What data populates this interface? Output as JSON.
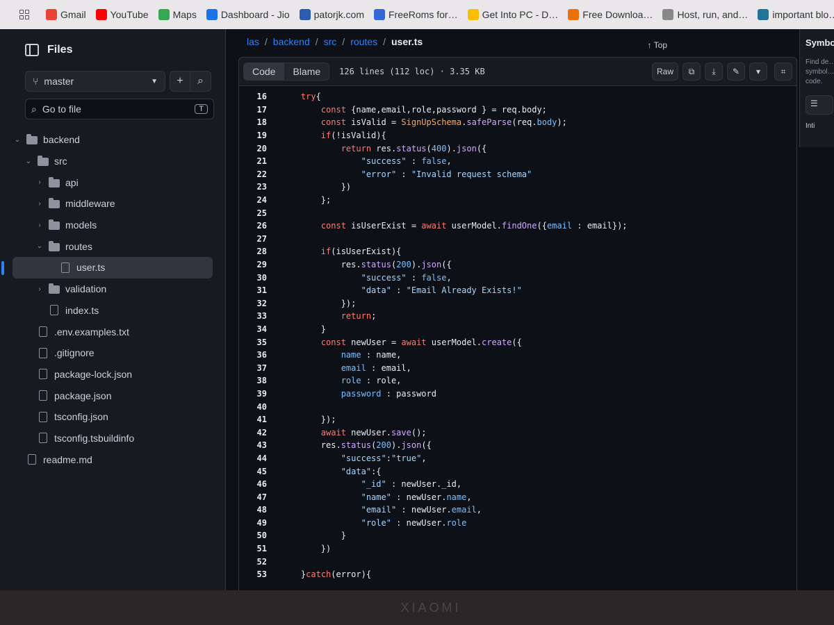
{
  "bookmarks": [
    {
      "label": "Gmail",
      "icon": "gmail-icon",
      "color": "#ea4335"
    },
    {
      "label": "YouTube",
      "icon": "youtube-icon",
      "color": "#ff0000"
    },
    {
      "label": "Maps",
      "icon": "maps-icon",
      "color": "#34a853"
    },
    {
      "label": "Dashboard - Jio",
      "icon": "cloud-icon",
      "color": "#1a73e8"
    },
    {
      "label": "patorjk.com",
      "icon": "pen-icon",
      "color": "#2a5db0"
    },
    {
      "label": "FreeRoms for…",
      "icon": "roms-icon",
      "color": "#3367d6"
    },
    {
      "label": "Get Into PC - D…",
      "icon": "g-icon",
      "color": "#fbbc04"
    },
    {
      "label": "Free Downloa…",
      "icon": "download-icon",
      "color": "#e8710a"
    },
    {
      "label": "Host, run, and…",
      "icon": "host-icon",
      "color": "#888888"
    },
    {
      "label": "important blo…",
      "icon": "wordpress-icon",
      "color": "#21759b"
    }
  ],
  "sidebar": {
    "title": "Files",
    "branch": "master",
    "goto_placeholder": "Go to file",
    "goto_shortcut": "T",
    "tree": [
      {
        "label": "backend",
        "type": "folder",
        "depth": 0,
        "chevron": "⌄"
      },
      {
        "label": "src",
        "type": "folder",
        "depth": 1,
        "chevron": "⌄"
      },
      {
        "label": "api",
        "type": "folder",
        "depth": 2,
        "chevron": "›"
      },
      {
        "label": "middleware",
        "type": "folder",
        "depth": 2,
        "chevron": "›"
      },
      {
        "label": "models",
        "type": "folder",
        "depth": 2,
        "chevron": "›"
      },
      {
        "label": "routes",
        "type": "folder",
        "depth": 2,
        "chevron": "⌄"
      },
      {
        "label": "user.ts",
        "type": "file",
        "depth": 3,
        "chevron": "",
        "selected": true
      },
      {
        "label": "validation",
        "type": "folder",
        "depth": 2,
        "chevron": "›"
      },
      {
        "label": "index.ts",
        "type": "file",
        "depth": 2,
        "chevron": ""
      },
      {
        "label": ".env.examples.txt",
        "type": "file",
        "depth": 1,
        "chevron": ""
      },
      {
        "label": ".gitignore",
        "type": "file",
        "depth": 1,
        "chevron": ""
      },
      {
        "label": "package-lock.json",
        "type": "file",
        "depth": 1,
        "chevron": ""
      },
      {
        "label": "package.json",
        "type": "file",
        "depth": 1,
        "chevron": ""
      },
      {
        "label": "tsconfig.json",
        "type": "file",
        "depth": 1,
        "chevron": ""
      },
      {
        "label": "tsconfig.tsbuildinfo",
        "type": "file",
        "depth": 1,
        "chevron": ""
      },
      {
        "label": "readme.md",
        "type": "file",
        "depth": 0,
        "chevron": ""
      }
    ]
  },
  "breadcrumb": {
    "parts": [
      "las",
      "backend",
      "src",
      "routes"
    ],
    "current": "user.ts"
  },
  "top_link": "↑ Top",
  "toolbar": {
    "code_tab": "Code",
    "blame_tab": "Blame",
    "file_info": "126 lines (112 loc) · 3.35 KB",
    "raw": "Raw"
  },
  "symbols": {
    "title": "Symbols",
    "desc": "Find de…",
    "desc2": "symbol…",
    "desc3": "code.",
    "filter": "Inti"
  },
  "bezel_brand": "XIAOMI",
  "code": {
    "lines": [
      {
        "n": "16",
        "html": "    <span class='kw'>try</span>{"
      },
      {
        "n": "17",
        "html": "        <span class='kw'>const</span> {name,email,role,password } = req.body;"
      },
      {
        "n": "18",
        "html": "        <span class='kw'>const</span> isValid = <span class='cls'>SignUpSchema</span>.<span class='fn'>safeParse</span>(req.<span class='num'>body</span>);"
      },
      {
        "n": "19",
        "html": "        <span class='kw'>if</span>(!isValid){"
      },
      {
        "n": "20",
        "html": "            <span class='kw'>return</span> res.<span class='fn'>status</span>(<span class='num'>400</span>).<span class='fn'>json</span>({"
      },
      {
        "n": "21",
        "html": "                <span class='str'>\"success\"</span> : <span class='num'>false</span>,"
      },
      {
        "n": "22",
        "html": "                <span class='str'>\"error\"</span> : <span class='str'>\"Invalid request schema\"</span>"
      },
      {
        "n": "23",
        "html": "            })"
      },
      {
        "n": "24",
        "html": "        };"
      },
      {
        "n": "25",
        "html": ""
      },
      {
        "n": "26",
        "html": "        <span class='kw'>const</span> isUserExist = <span class='kw'>await</span> userModel.<span class='fn'>findOne</span>({<span class='num'>email</span> : email});"
      },
      {
        "n": "27",
        "html": ""
      },
      {
        "n": "28",
        "html": "        <span class='kw'>if</span>(isUserExist){"
      },
      {
        "n": "29",
        "html": "            res.<span class='fn'>status</span>(<span class='num'>200</span>).<span class='fn'>json</span>({"
      },
      {
        "n": "30",
        "html": "                <span class='str'>\"success\"</span> : <span class='num'>false</span>,"
      },
      {
        "n": "31",
        "html": "                <span class='str'>\"data\"</span> : <span class='str'>\"Email Already Exists!\"</span>"
      },
      {
        "n": "32",
        "html": "            });"
      },
      {
        "n": "33",
        "html": "            <span class='kw'>return</span>;"
      },
      {
        "n": "34",
        "html": "        }"
      },
      {
        "n": "35",
        "html": "        <span class='kw'>const</span> newUser = <span class='kw'>await</span> userModel.<span class='fn'>create</span>({"
      },
      {
        "n": "36",
        "html": "            <span class='num'>name</span> : name,"
      },
      {
        "n": "37",
        "html": "            <span class='num'>email</span> : email,"
      },
      {
        "n": "38",
        "html": "            <span class='num'>role</span> : role,"
      },
      {
        "n": "39",
        "html": "            <span class='num'>password</span> : password"
      },
      {
        "n": "40",
        "html": ""
      },
      {
        "n": "41",
        "html": "        });"
      },
      {
        "n": "42",
        "html": "        <span class='kw'>await</span> newUser.<span class='fn'>save</span>();"
      },
      {
        "n": "43",
        "html": "        res.<span class='fn'>status</span>(<span class='num'>200</span>).<span class='fn'>json</span>({"
      },
      {
        "n": "44",
        "html": "            <span class='str'>\"success\"</span>:<span class='str'>\"true\"</span>,"
      },
      {
        "n": "45",
        "html": "            <span class='str'>\"data\"</span>:{"
      },
      {
        "n": "46",
        "html": "                <span class='str'>\"_id\"</span> : newUser._id,"
      },
      {
        "n": "47",
        "html": "                <span class='str'>\"name\"</span> : newUser.<span class='num'>name</span>,"
      },
      {
        "n": "48",
        "html": "                <span class='str'>\"email\"</span> : newUser.<span class='num'>email</span>,"
      },
      {
        "n": "49",
        "html": "                <span class='str'>\"role\"</span> : newUser.<span class='num'>role</span>"
      },
      {
        "n": "50",
        "html": "            }"
      },
      {
        "n": "51",
        "html": "        })"
      },
      {
        "n": "52",
        "html": ""
      },
      {
        "n": "53",
        "html": "    }<span class='kw'>catch</span>(error){"
      }
    ]
  }
}
